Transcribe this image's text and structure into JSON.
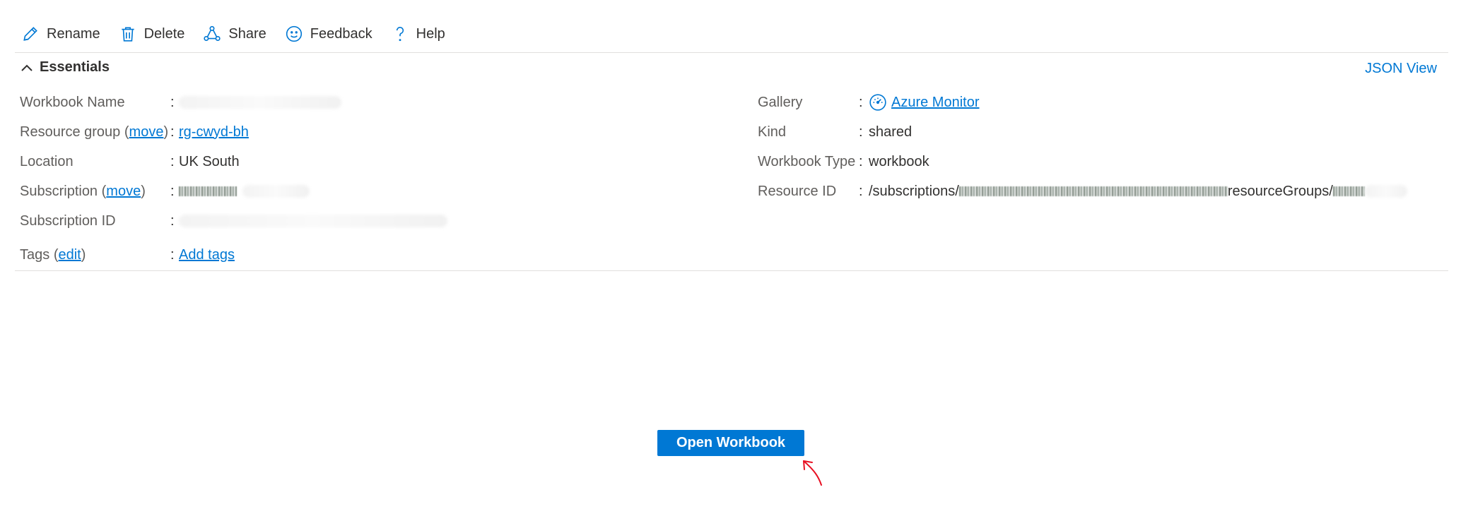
{
  "toolbar": {
    "rename": "Rename",
    "delete": "Delete",
    "share": "Share",
    "feedback": "Feedback",
    "help": "Help"
  },
  "essentials": {
    "title": "Essentials",
    "json_view": "JSON View",
    "left": {
      "workbook_name_label": "Workbook Name",
      "resource_group_label": "Resource group",
      "resource_group_move": "move",
      "resource_group_value": "rg-cwyd-bh",
      "location_label": "Location",
      "location_value": "UK South",
      "subscription_label": "Subscription",
      "subscription_move": "move",
      "subscription_id_label": "Subscription ID",
      "tags_label": "Tags",
      "tags_edit": "edit",
      "tags_value": "Add tags"
    },
    "right": {
      "gallery_label": "Gallery",
      "gallery_value": "Azure Monitor",
      "kind_label": "Kind",
      "kind_value": "shared",
      "workbook_type_label": "Workbook Type",
      "workbook_type_value": "workbook",
      "resource_id_label": "Resource ID",
      "resource_id_prefix": "/subscriptions/",
      "resource_id_mid": "resourceGroups/"
    },
    "colon": ":",
    "paren_open": "(",
    "paren_close": ")"
  },
  "main": {
    "open_workbook": "Open Workbook"
  },
  "colors": {
    "accent": "#0078d4",
    "annotation": "#e81123"
  },
  "icons": [
    "pencil-icon",
    "trash-icon",
    "share-icon",
    "smiley-icon",
    "question-icon",
    "chevron-up-icon",
    "gauge-icon",
    "annotation-arrow"
  ]
}
